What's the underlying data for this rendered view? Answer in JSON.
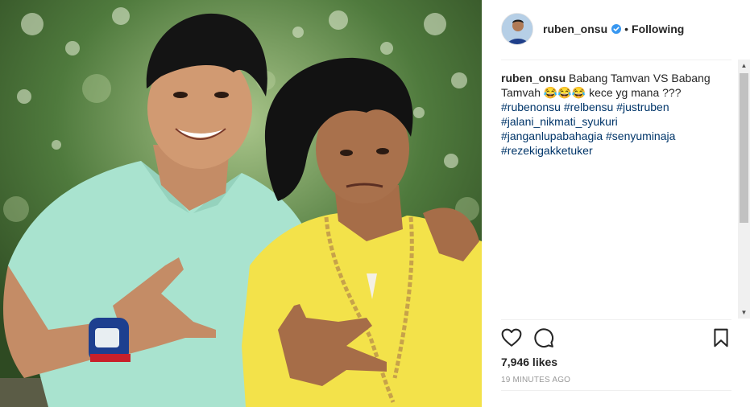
{
  "post": {
    "username": "ruben_onsu",
    "follow_state": "Following",
    "separator": "•",
    "caption_user": "ruben_onsu",
    "caption_text": "Babang Tamvan VS Babang Tamvah 😂😂😂 kece yg mana ???",
    "hashtags": [
      "#rubenonsu #relbensu #justruben",
      "#jalani_nikmati_syukuri",
      "#janganlupabahagia #senyuminaja",
      "#rezekigakketuker"
    ],
    "likes": "7,946 likes",
    "timestamp": "19 MINUTES AGO"
  },
  "icons": {
    "verified": "verified-badge-icon",
    "like": "heart-icon",
    "comment": "comment-bubble-icon",
    "save": "bookmark-icon"
  },
  "colors": {
    "verified_blue": "#3897f0",
    "hashtag_blue": "#003569",
    "timestamp_gray": "#999999",
    "shirt_mint": "#a9e3cf",
    "shirt_yellow": "#f3e24a"
  }
}
